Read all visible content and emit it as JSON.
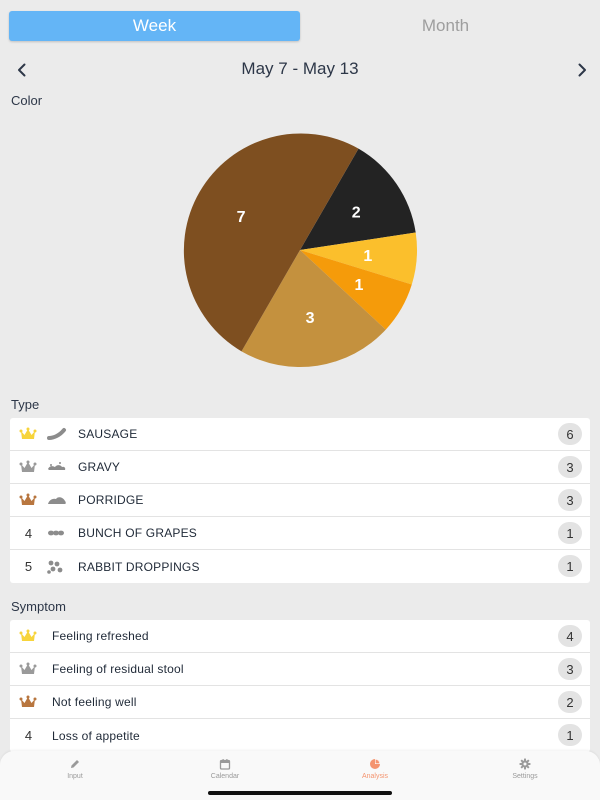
{
  "segmented": {
    "week": "Week",
    "month": "Month",
    "selected": "Week"
  },
  "date_nav": {
    "range": "May 7 - May 13"
  },
  "color_section": {
    "title": "Color"
  },
  "chart_data": {
    "type": "pie",
    "slices": [
      {
        "value": 2,
        "color": "#232323",
        "label": "2"
      },
      {
        "value": 1,
        "color": "#fbbf2c",
        "label": "1"
      },
      {
        "value": 1,
        "color": "#f59b0a",
        "label": "1"
      },
      {
        "value": 3,
        "color": "#c4913e",
        "label": "3"
      },
      {
        "value": 7,
        "color": "#7e4f20",
        "label": "7"
      }
    ],
    "start_angle_deg": 30,
    "direction": "clockwise"
  },
  "type_section": {
    "title": "Type",
    "items": [
      {
        "rank": "",
        "crown": "gold",
        "icon": "sausage-icon",
        "label": "SAUSAGE",
        "count": "6"
      },
      {
        "rank": "",
        "crown": "silver",
        "icon": "gravy-icon",
        "label": "GRAVY",
        "count": "3"
      },
      {
        "rank": "",
        "crown": "bronze",
        "icon": "porridge-icon",
        "label": "PORRIDGE",
        "count": "3"
      },
      {
        "rank": "4",
        "crown": "",
        "icon": "bunch-of-grapes-icon",
        "label": "BUNCH OF GRAPES",
        "count": "1"
      },
      {
        "rank": "5",
        "crown": "",
        "icon": "rabbit-droppings-icon",
        "label": "RABBIT DROPPINGS",
        "count": "1"
      }
    ]
  },
  "symptom_section": {
    "title": "Symptom",
    "items": [
      {
        "rank": "",
        "crown": "gold",
        "label": "Feeling refreshed",
        "count": "4"
      },
      {
        "rank": "",
        "crown": "silver",
        "label": "Feeling of residual stool",
        "count": "3"
      },
      {
        "rank": "",
        "crown": "bronze",
        "label": "Not feeling well",
        "count": "2"
      },
      {
        "rank": "4",
        "crown": "",
        "label": "Loss of appetite",
        "count": "1"
      }
    ]
  },
  "colors": {
    "gold": "#f7d43b",
    "silver": "#9a9a9a",
    "bronze": "#b8763f",
    "accent": "#f4946f",
    "segment": "#64b5f6"
  },
  "tabbar": {
    "tabs": [
      {
        "label": "Input",
        "icon": "pencil-icon",
        "active": false
      },
      {
        "label": "Calendar",
        "icon": "calendar-icon",
        "active": false
      },
      {
        "label": "Analysis",
        "icon": "pie-chart-icon",
        "active": true
      },
      {
        "label": "Settings",
        "icon": "gear-icon",
        "active": false
      }
    ]
  }
}
